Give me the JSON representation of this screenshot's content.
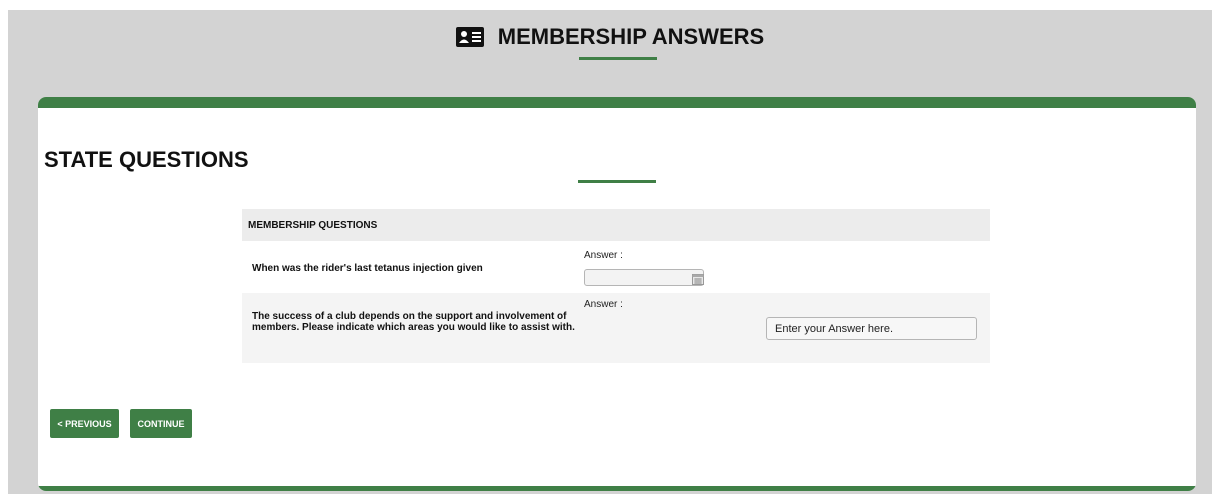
{
  "header": {
    "title": "MEMBERSHIP ANSWERS",
    "icon": "id-card-icon"
  },
  "section": {
    "title": "STATE QUESTIONS"
  },
  "questions": {
    "header": "MEMBERSHIP QUESTIONS",
    "items": [
      {
        "text": "When was the rider's last tetanus injection given",
        "answer_label": "Answer :",
        "answer_value": ""
      },
      {
        "text": "The success of a club depends on the support and involvement of members. Please indicate which areas you would like to assist with.",
        "answer_label": "Answer :",
        "placeholder": "Enter your Answer here."
      }
    ]
  },
  "buttons": {
    "previous": "< PREVIOUS",
    "continue": "CONTINUE"
  },
  "colors": {
    "accent": "#3f7f46",
    "page_bg": "#d3d3d3"
  }
}
